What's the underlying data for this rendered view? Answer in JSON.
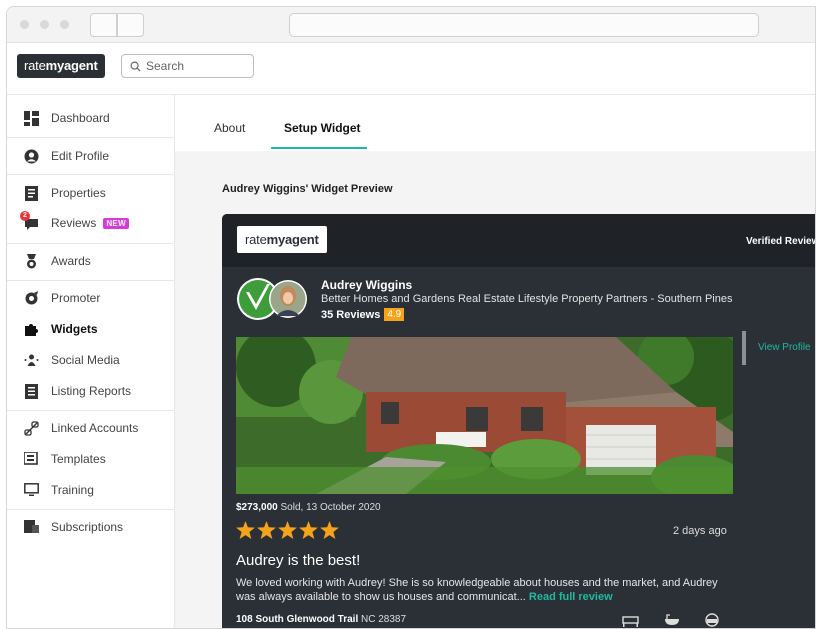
{
  "header": {
    "logo_prefix": "rate",
    "logo_bold": "my",
    "logo_suffix": "agent",
    "search_placeholder": "Search"
  },
  "sidebar": {
    "items": [
      {
        "label": "Dashboard",
        "icon": "dashboard-icon"
      },
      {
        "label": "Edit Profile",
        "icon": "user-icon"
      },
      {
        "label": "Properties",
        "icon": "properties-icon"
      },
      {
        "label": "Reviews",
        "icon": "reviews-icon",
        "badge": "NEW",
        "notification": "2"
      },
      {
        "label": "Awards",
        "icon": "award-icon"
      },
      {
        "label": "Promoter",
        "icon": "promoter-icon"
      },
      {
        "label": "Widgets",
        "icon": "puzzle-icon",
        "active": true
      },
      {
        "label": "Social Media",
        "icon": "social-icon"
      },
      {
        "label": "Listing Reports",
        "icon": "report-icon"
      },
      {
        "label": "Linked Accounts",
        "icon": "link-icon"
      },
      {
        "label": "Templates",
        "icon": "template-icon"
      },
      {
        "label": "Training",
        "icon": "monitor-icon"
      },
      {
        "label": "Subscriptions",
        "icon": "subscription-icon"
      }
    ]
  },
  "main": {
    "tabs": [
      {
        "label": "About",
        "active": false
      },
      {
        "label": "Setup Widget",
        "active": true
      }
    ],
    "preview_title": "Audrey Wiggins' Widget Preview"
  },
  "widget": {
    "logo_prefix": "rate",
    "logo_bold": "my",
    "logo_suffix": "agent",
    "verified_label": "Verified Reviews",
    "agent_name": "Audrey Wiggins",
    "agent_company": "Better Homes and Gardens Real Estate Lifestyle Property Partners - Southern Pines",
    "reviews_count": "35 Reviews",
    "rating": "4.9",
    "view_profile": "View Profile",
    "sold_price": "$273,000",
    "sold_text": " Sold, 13 October 2020",
    "stars": 5,
    "time_ago": "2 days ago",
    "review_title": "Audrey is the best!",
    "review_body": "We loved working with Audrey! She is so knowledgeable about houses and the market, and Audrey was always available to show us houses and communicat...",
    "read_full": "Read full review",
    "address_street": "108 South Glenwood Trail",
    "address_rest": " NC 28387"
  },
  "colors": {
    "accent": "#1fb9a1",
    "widget_bg": "#2b2f36",
    "rating_bg": "#f5a31b",
    "badge_new": "#d63bd8"
  }
}
